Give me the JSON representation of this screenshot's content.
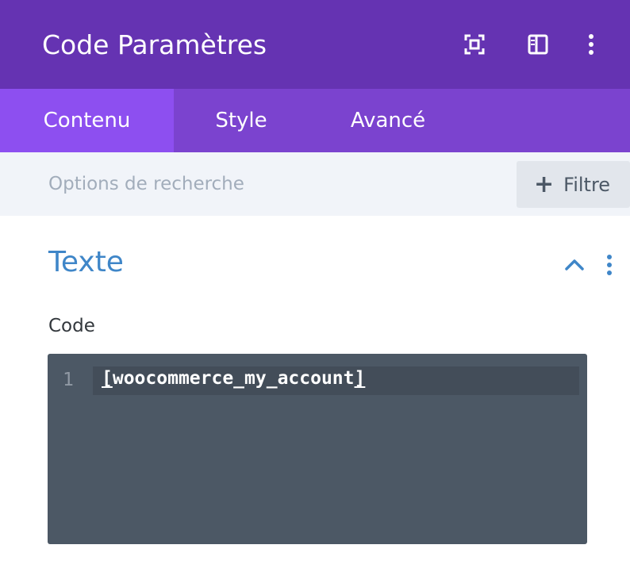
{
  "header": {
    "title": "Code Paramètres",
    "icons": [
      "focus-frame-icon",
      "split-panel-icon",
      "more-vertical-icon"
    ]
  },
  "tabs": [
    {
      "label": "Contenu",
      "active": true
    },
    {
      "label": "Style",
      "active": false
    },
    {
      "label": "Avancé",
      "active": false
    }
  ],
  "search": {
    "placeholder": "Options de recherche",
    "filter_label": "Filtre"
  },
  "section": {
    "title": "Texte",
    "icons": [
      "chevron-up-icon",
      "more-vertical-icon"
    ]
  },
  "code_field": {
    "label": "Code",
    "line_number": "1",
    "bracket_open": "[",
    "content": "woocommerce_my_account",
    "bracket_close": "]"
  },
  "colors": {
    "header_bg": "#6533b2",
    "tabs_bg": "#7b43cf",
    "active_tab_bg": "#8d4ff0",
    "section_title": "#3f86c8",
    "editor_bg": "#4c5865"
  }
}
